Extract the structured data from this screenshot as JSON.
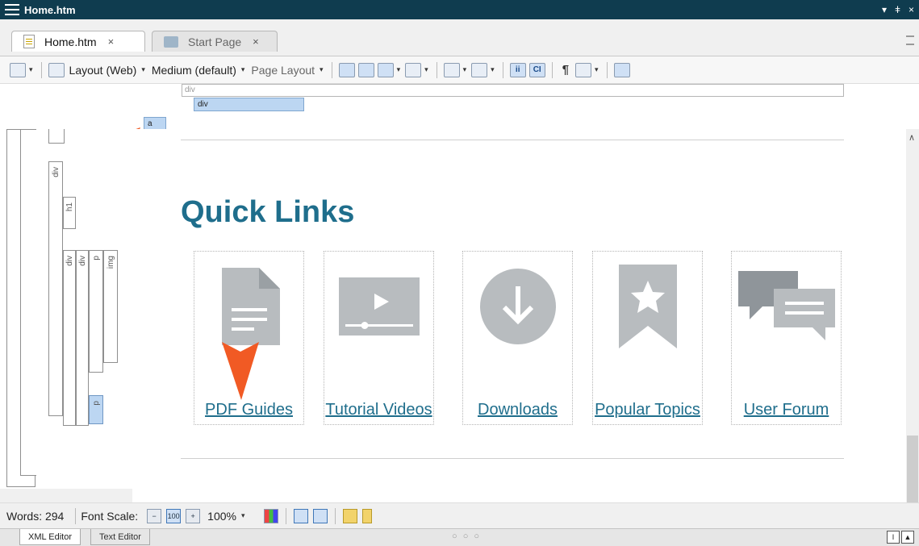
{
  "window": {
    "title": "Home.htm",
    "controls": [
      "▾",
      "ǂ",
      "×"
    ]
  },
  "tabs": [
    {
      "label": "Home.htm",
      "close": "×"
    },
    {
      "label": "Start Page",
      "close": "×"
    }
  ],
  "toolbar": {
    "layout_label": "Layout (Web)",
    "medium_label": "Medium (default)",
    "page_layout_label": "Page Layout",
    "pilcrow": "¶",
    "btn_i": "ii",
    "btn_c": "CI"
  },
  "structure": {
    "div_outer": "div",
    "div_inner": "div",
    "a_tag": "a",
    "left_labels": [
      "div",
      "h1",
      "div",
      "div",
      "p",
      "img",
      "p"
    ]
  },
  "content": {
    "title": "Quick Links",
    "cards": [
      {
        "label": "PDF Guides",
        "icon": "document-icon"
      },
      {
        "label": "Tutorial Videos",
        "icon": "video-icon"
      },
      {
        "label": "Downloads",
        "icon": "download-icon"
      },
      {
        "label": "Popular Topics",
        "icon": "bookmark-star-icon"
      },
      {
        "label": "User Forum",
        "icon": "chat-bubbles-icon"
      }
    ],
    "icon_color": "#b8bcbf",
    "link_color": "#1f6e8c"
  },
  "statusbar": {
    "words": "Words: 294",
    "font_scale": "Font Scale:",
    "zoom": "100%",
    "btn_100": "100",
    "btn_plus": "+"
  },
  "bottom_tabs": [
    {
      "label": "XML Editor"
    },
    {
      "label": "Text Editor"
    }
  ],
  "bottom_dots": "○ ○ ○",
  "accent_color": "#f15a24"
}
